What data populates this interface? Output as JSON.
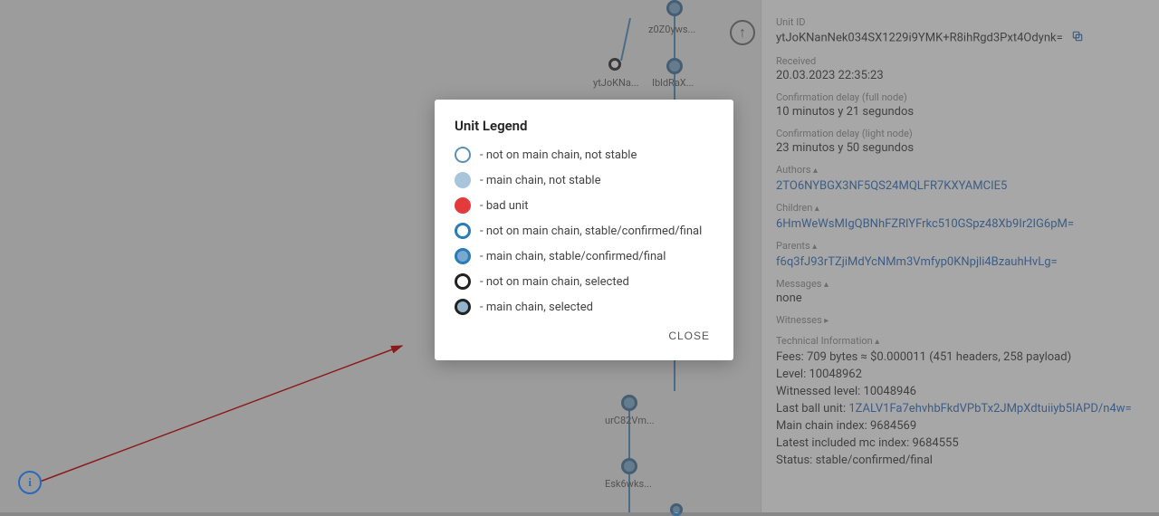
{
  "dag": {
    "nodes": [
      {
        "id": "top",
        "label": ""
      },
      {
        "id": "z0Z0yws",
        "label": "z0Z0yws..."
      },
      {
        "id": "ytJoKNa",
        "label": "ytJoKNa..."
      },
      {
        "id": "IbldRaX",
        "label": "IbldRaX..."
      },
      {
        "id": "urC82Vm",
        "label": "urC82Vm..."
      },
      {
        "id": "Esk6wks",
        "label": "Esk6wks..."
      }
    ]
  },
  "modal": {
    "title": "Unit Legend",
    "items": [
      {
        "cls": "lc-white-thin",
        "text": "- not on main chain, not stable"
      },
      {
        "cls": "lc-lightblue",
        "text": "- main chain, not stable"
      },
      {
        "cls": "lc-red",
        "text": "- bad unit"
      },
      {
        "cls": "lc-white-thick",
        "text": "- not on main chain, stable/confirmed/final"
      },
      {
        "cls": "lc-blue-thick",
        "text": "- main chain, stable/confirmed/final"
      },
      {
        "cls": "lc-white-black",
        "text": "- not on main chain, selected"
      },
      {
        "cls": "lc-blue-black",
        "text": "- main chain, selected"
      }
    ],
    "close": "CLOSE"
  },
  "scroll_top_glyph": "↑",
  "info_glyph": "i",
  "sidebar": {
    "labels": {
      "unit_id": "Unit ID",
      "received": "Received",
      "conf_full": "Confirmation delay (full node)",
      "conf_light": "Confirmation delay (light node)",
      "authors": "Authors",
      "children": "Children",
      "parents": "Parents",
      "messages": "Messages",
      "witnesses": "Witnesses",
      "tech": "Technical Information"
    },
    "unit_id": "ytJoKNanNek034SX1229i9YMK+R8ihRgd3Pxt4Odynk=",
    "received": "20.03.2023 22:35:23",
    "conf_full": "10 minutos y 21 segundos",
    "conf_light": "23 minutos y 50 segundos",
    "authors": [
      "2TO6NYBGX3NF5QS24MQLFR7KXYAMCIE5"
    ],
    "children": [
      "6HmWeWsMIgQBNhFZRlYFrkc510GSpz48Xb9Ir2IG6pM="
    ],
    "parents": [
      "f6q3fJ93rTZjiMdYcNMm3Vmfyp0KNpjli4BzauhHvLg="
    ],
    "messages": "none",
    "tech": {
      "fees_label": "Fees:",
      "fees_value": "709 bytes ≈ $0.000011 (451 headers, 258 payload)",
      "level_label": "Level:",
      "level_value": "10048962",
      "witnessed_label": "Witnessed level:",
      "witnessed_value": "10048946",
      "lastball_label": "Last ball unit:",
      "lastball_link": "1ZALV1Fa7ehvhbFkdVPbTx2JMpXdtuiiyb5IAPD/n4w=",
      "mci_label": "Main chain index:",
      "mci_value": "9684569",
      "latest_mci_label": "Latest included mc index:",
      "latest_mci_value": "9684555",
      "status_label": "Status:",
      "status_value": "stable/confirmed/final"
    }
  }
}
